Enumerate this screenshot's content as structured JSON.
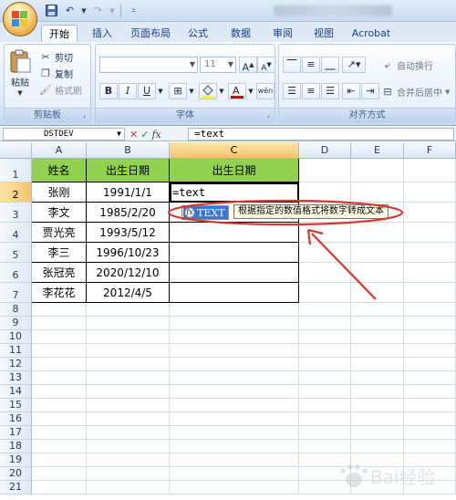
{
  "tabs": [
    {
      "label": "开始",
      "active": true
    },
    {
      "label": "插入"
    },
    {
      "label": "页面布局"
    },
    {
      "label": "公式"
    },
    {
      "label": "数据"
    },
    {
      "label": "审阅"
    },
    {
      "label": "视图"
    },
    {
      "label": "Acrobat"
    }
  ],
  "ribbon": {
    "clipboard": {
      "paste": "粘贴",
      "cut": "剪切",
      "copy": "复制",
      "format_painter": "格式刷",
      "label": "剪贴板"
    },
    "font": {
      "font_size": "11",
      "label": "字体",
      "bold": "B",
      "italic": "I",
      "underline": "U",
      "grow": "A",
      "shrink": "A",
      "phonetic": "wén"
    },
    "alignment": {
      "wrap_text": "自动换行",
      "merge_center": "合并后居中",
      "label": "对齐方式"
    }
  },
  "formula_bar": {
    "name_box": "DSTDEV",
    "fx": "fx",
    "content": "=text"
  },
  "columns": [
    "A",
    "B",
    "C",
    "D",
    "E",
    "F"
  ],
  "rows": [
    "1",
    "2",
    "3",
    "4",
    "5",
    "6",
    "7",
    "8",
    "9",
    "10",
    "11",
    "12",
    "13",
    "14",
    "15",
    "16",
    "17",
    "18",
    "19",
    "20",
    "21"
  ],
  "table": {
    "headers": [
      "姓名",
      "出生日期",
      "出生日期"
    ],
    "names": [
      "张刚",
      "李文",
      "贾光亮",
      "李三",
      "张冠亮",
      "李花花"
    ],
    "dates": [
      "1991/1/1",
      "1985/2/20",
      "1993/5/12",
      "1996/10/23",
      "2020/12/10",
      "2012/4/5"
    ]
  },
  "editing_cell": {
    "text": "=text"
  },
  "autocomplete": {
    "item": "TEXT",
    "tooltip": "根据指定的数值格式将数字转成文本"
  },
  "colors": {
    "header_fill": "#92d050",
    "selection_header": "#f3c46b",
    "annotation": "#d9352f",
    "autocomplete_highlight": "#3a78d4"
  },
  "watermark": {
    "text": "Bai经验"
  }
}
